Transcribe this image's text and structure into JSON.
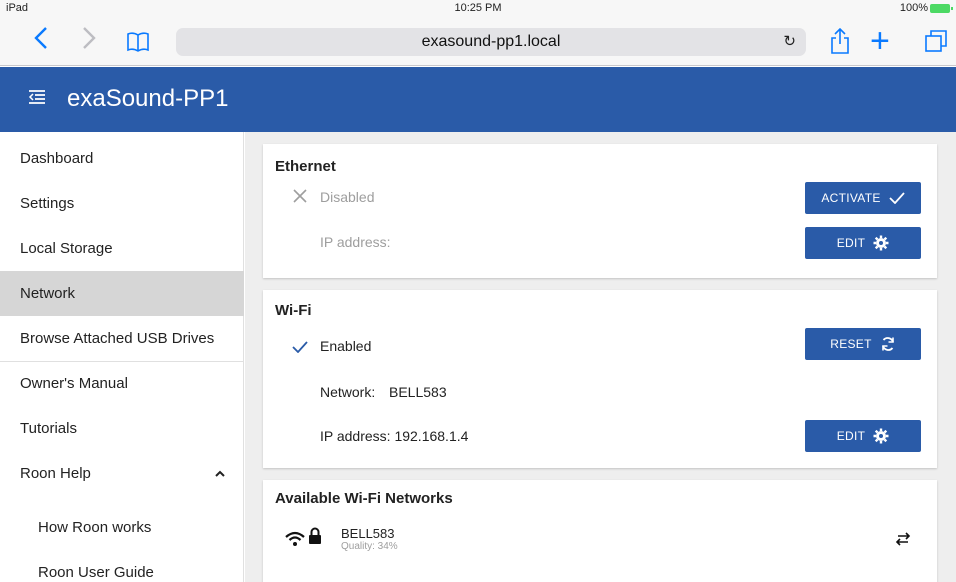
{
  "status_bar": {
    "device": "iPad",
    "time": "10:25 PM",
    "battery": "100%"
  },
  "browser": {
    "url": "exasound-pp1.local"
  },
  "app": {
    "title": "exaSound-PP1"
  },
  "sidebar": {
    "items": [
      {
        "label": "Dashboard"
      },
      {
        "label": "Settings"
      },
      {
        "label": "Local Storage"
      },
      {
        "label": "Network"
      },
      {
        "label": "Browse Attached USB Drives"
      },
      {
        "label": "Owner's Manual"
      },
      {
        "label": "Tutorials"
      },
      {
        "label": "Roon Help"
      },
      {
        "label": "How Roon works"
      },
      {
        "label": "Roon User Guide"
      }
    ],
    "active": "Network"
  },
  "ethernet": {
    "title": "Ethernet",
    "status": "Disabled",
    "ip_label": "IP address:",
    "activate_label": "ACTIVATE",
    "edit_label": "EDIT"
  },
  "wifi": {
    "title": "Wi-Fi",
    "status": "Enabled",
    "network_label": "Network:",
    "network_value": "BELL583",
    "ip_text": "IP address: 192.168.1.4",
    "reset_label": "RESET",
    "edit_label": "EDIT"
  },
  "available": {
    "title": "Available Wi-Fi Networks",
    "networks": [
      {
        "ssid": "BELL583",
        "quality": "Quality: 34%"
      }
    ]
  },
  "colors": {
    "brand": "#2a5ba8",
    "ios_blue": "#0a7aff",
    "active_nav": "#d6d6d6"
  }
}
